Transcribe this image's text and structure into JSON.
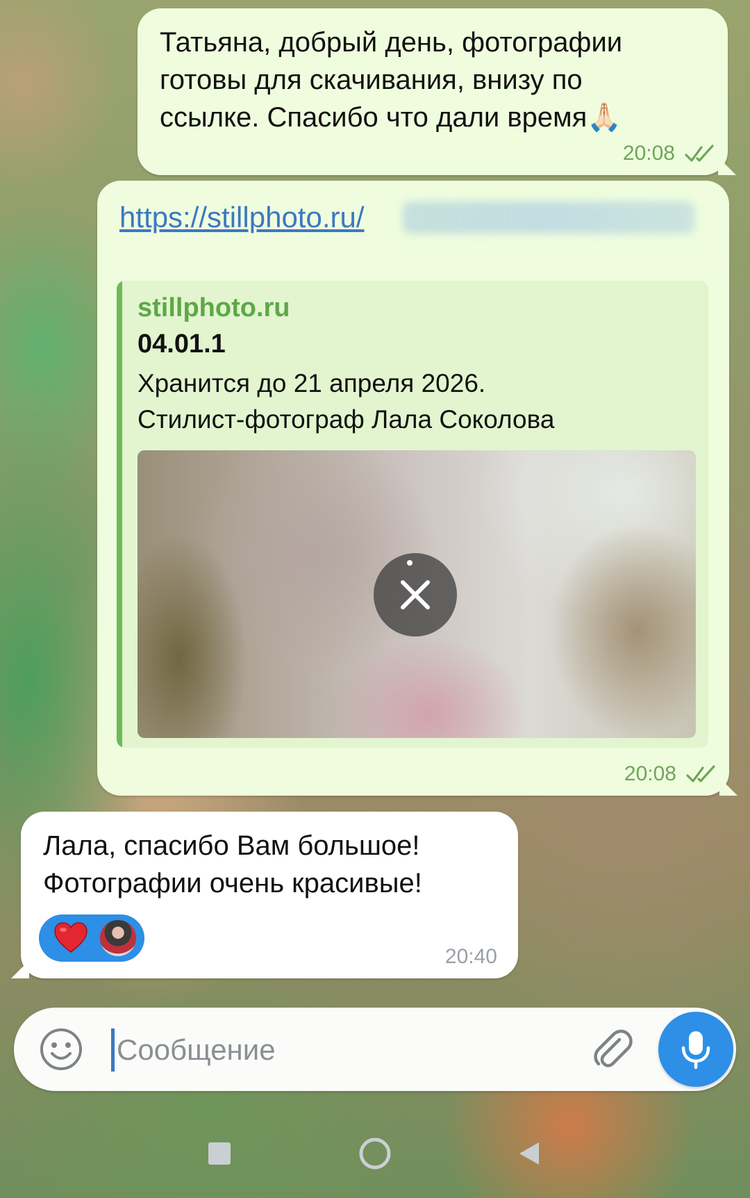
{
  "messages": [
    {
      "direction": "outgoing",
      "lines": [
        "Татьяна, добрый день, фотографии",
        "готовы для скачивания, внизу по",
        "ссылке. Спасибо что дали время🙏🏻"
      ],
      "time": "20:08",
      "status": "read"
    },
    {
      "direction": "outgoing",
      "link_text": "https://stillphoto.ru/",
      "preview": {
        "site": "stillphoto.ru",
        "title": "04.01.1",
        "description": [
          "Хранится до 21 апреля 2026.",
          "Стилист-фотограф Лала Соколова"
        ]
      },
      "time": "20:08",
      "status": "read"
    },
    {
      "direction": "incoming",
      "lines": [
        "Лала, спасибо Вам большое!",
        "Фотографии очень красивые!"
      ],
      "time": "20:40",
      "reactions": [
        "heart"
      ]
    }
  ],
  "composer": {
    "placeholder": "Сообщение"
  },
  "colors": {
    "outgoing_bubble": "#effdde",
    "incoming_bubble": "#ffffff",
    "accent": "#2d8fe6",
    "link": "#3b78c2",
    "time_outgoing": "#6fa55a",
    "time_incoming": "#9aa0a6"
  },
  "icons": {
    "composer_left": "emoji-icon",
    "composer_right": "paperclip-icon",
    "send_action": "microphone-icon",
    "status": "double-check-icon",
    "nav": [
      "recent-apps-icon",
      "home-icon",
      "back-icon"
    ]
  }
}
